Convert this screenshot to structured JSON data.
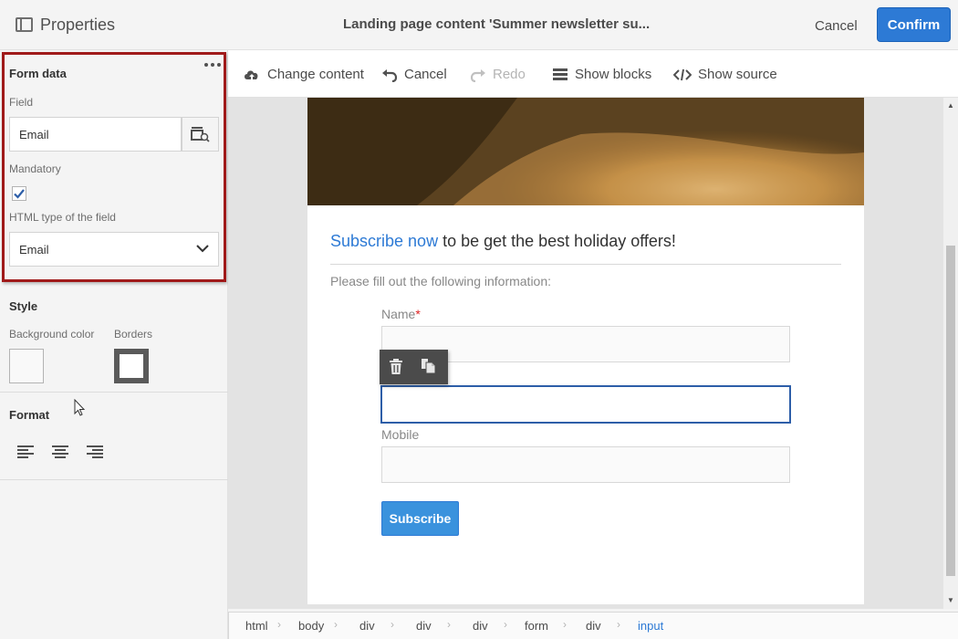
{
  "topbar": {
    "properties_title": "Properties",
    "document_title": "Landing page content 'Summer newsletter su...",
    "cancel_label": "Cancel",
    "confirm_label": "Confirm"
  },
  "left_panel": {
    "form_data": {
      "section_title": "Form data",
      "field_label": "Field",
      "field_value": "Email",
      "mandatory_label": "Mandatory",
      "mandatory_checked": true,
      "html_type_label": "HTML type of the field",
      "html_type_value": "Email"
    },
    "style": {
      "section_title": "Style",
      "background_color_label": "Background color",
      "background_color": "#f9f9f9",
      "borders_label": "Borders",
      "border_color": "#5a5a5a"
    },
    "format": {
      "section_title": "Format",
      "align_options": [
        "align-left",
        "align-center",
        "align-right"
      ]
    }
  },
  "toolbar": {
    "change_content": "Change content",
    "cancel": "Cancel",
    "redo": "Redo",
    "show_blocks": "Show blocks",
    "show_source": "Show source"
  },
  "email_content": {
    "headline_link": "Subscribe now",
    "headline_rest": " to be get the best holiday offers!",
    "intro": "Please fill out the following information:",
    "fields": [
      {
        "label": "Name",
        "required": "*"
      },
      {
        "label": "Mobile"
      }
    ],
    "subscribe_label": "Subscribe"
  },
  "breadcrumb": [
    "html",
    "body",
    "div",
    "div",
    "div",
    "form",
    "div",
    "input"
  ],
  "colors": {
    "accent": "#2d7ad5",
    "highlight_border": "#a01a1a"
  }
}
